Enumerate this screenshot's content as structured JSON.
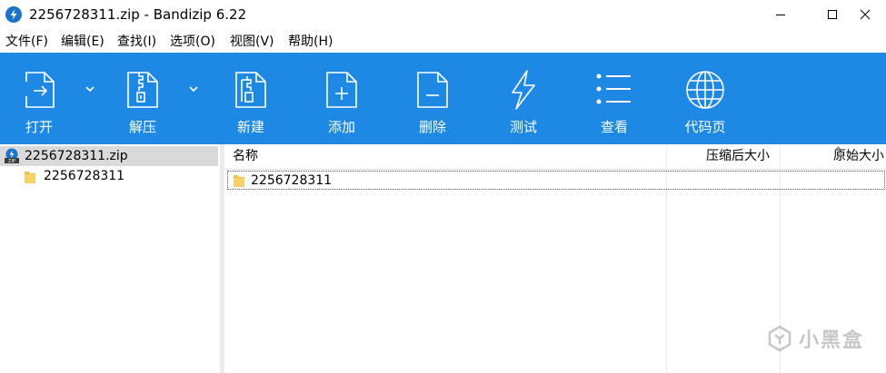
{
  "window": {
    "title": "2256728311.zip - Bandizip 6.22",
    "icon": "bandizip-app-icon",
    "controls": [
      "minimize-icon",
      "maximize-icon",
      "close-icon"
    ]
  },
  "menu": [
    {
      "label": "文件(F)"
    },
    {
      "label": "编辑(E)"
    },
    {
      "label": "查找(I)"
    },
    {
      "label": "选项(O)"
    },
    {
      "label": "视图(V)"
    },
    {
      "label": "帮助(H)"
    }
  ],
  "toolbar": {
    "background": "#1e88e5",
    "items": [
      {
        "label": "打开",
        "icon": "open-file-icon",
        "has_dropdown": true
      },
      {
        "label": "解压",
        "icon": "extract-archive-icon",
        "has_dropdown": true
      },
      {
        "label": "新建",
        "icon": "new-archive-icon"
      },
      {
        "label": "添加",
        "icon": "add-file-icon"
      },
      {
        "label": "删除",
        "icon": "delete-file-icon"
      },
      {
        "label": "测试",
        "icon": "test-lightning-icon"
      },
      {
        "label": "查看",
        "icon": "view-list-icon"
      },
      {
        "label": "代码页",
        "icon": "codepage-globe-icon"
      }
    ]
  },
  "tree": {
    "root": {
      "label": "2256728311.zip",
      "icon": "zip-archive-icon",
      "selected": true
    },
    "children": [
      {
        "label": "2256728311",
        "icon": "folder-icon"
      }
    ]
  },
  "list": {
    "columns": [
      {
        "label": "名称"
      },
      {
        "label": "压缩后大小"
      },
      {
        "label": "原始大小"
      }
    ],
    "rows": [
      {
        "name": "2256728311",
        "icon": "folder-icon",
        "compressed_size": "",
        "original_size": ""
      }
    ]
  },
  "watermark": {
    "text": "小黑盒"
  }
}
